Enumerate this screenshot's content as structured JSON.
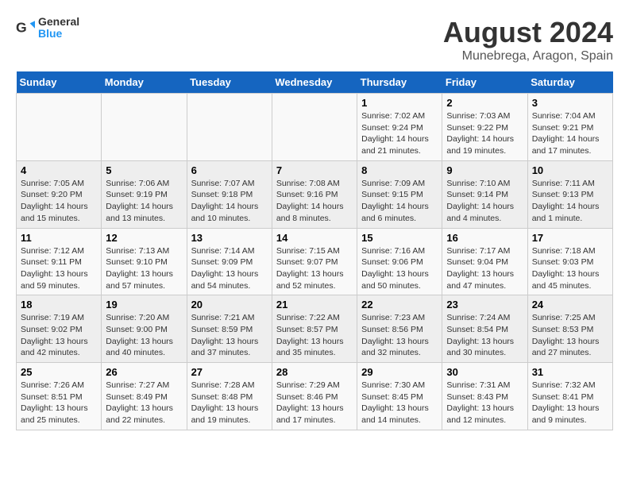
{
  "header": {
    "logo_general": "General",
    "logo_blue": "Blue",
    "title": "August 2024",
    "subtitle": "Munebrega, Aragon, Spain"
  },
  "calendar": {
    "days_of_week": [
      "Sunday",
      "Monday",
      "Tuesday",
      "Wednesday",
      "Thursday",
      "Friday",
      "Saturday"
    ],
    "weeks": [
      [
        {
          "day": "",
          "info": ""
        },
        {
          "day": "",
          "info": ""
        },
        {
          "day": "",
          "info": ""
        },
        {
          "day": "",
          "info": ""
        },
        {
          "day": "1",
          "info": "Sunrise: 7:02 AM\nSunset: 9:24 PM\nDaylight: 14 hours\nand 21 minutes."
        },
        {
          "day": "2",
          "info": "Sunrise: 7:03 AM\nSunset: 9:22 PM\nDaylight: 14 hours\nand 19 minutes."
        },
        {
          "day": "3",
          "info": "Sunrise: 7:04 AM\nSunset: 9:21 PM\nDaylight: 14 hours\nand 17 minutes."
        }
      ],
      [
        {
          "day": "4",
          "info": "Sunrise: 7:05 AM\nSunset: 9:20 PM\nDaylight: 14 hours\nand 15 minutes."
        },
        {
          "day": "5",
          "info": "Sunrise: 7:06 AM\nSunset: 9:19 PM\nDaylight: 14 hours\nand 13 minutes."
        },
        {
          "day": "6",
          "info": "Sunrise: 7:07 AM\nSunset: 9:18 PM\nDaylight: 14 hours\nand 10 minutes."
        },
        {
          "day": "7",
          "info": "Sunrise: 7:08 AM\nSunset: 9:16 PM\nDaylight: 14 hours\nand 8 minutes."
        },
        {
          "day": "8",
          "info": "Sunrise: 7:09 AM\nSunset: 9:15 PM\nDaylight: 14 hours\nand 6 minutes."
        },
        {
          "day": "9",
          "info": "Sunrise: 7:10 AM\nSunset: 9:14 PM\nDaylight: 14 hours\nand 4 minutes."
        },
        {
          "day": "10",
          "info": "Sunrise: 7:11 AM\nSunset: 9:13 PM\nDaylight: 14 hours\nand 1 minute."
        }
      ],
      [
        {
          "day": "11",
          "info": "Sunrise: 7:12 AM\nSunset: 9:11 PM\nDaylight: 13 hours\nand 59 minutes."
        },
        {
          "day": "12",
          "info": "Sunrise: 7:13 AM\nSunset: 9:10 PM\nDaylight: 13 hours\nand 57 minutes."
        },
        {
          "day": "13",
          "info": "Sunrise: 7:14 AM\nSunset: 9:09 PM\nDaylight: 13 hours\nand 54 minutes."
        },
        {
          "day": "14",
          "info": "Sunrise: 7:15 AM\nSunset: 9:07 PM\nDaylight: 13 hours\nand 52 minutes."
        },
        {
          "day": "15",
          "info": "Sunrise: 7:16 AM\nSunset: 9:06 PM\nDaylight: 13 hours\nand 50 minutes."
        },
        {
          "day": "16",
          "info": "Sunrise: 7:17 AM\nSunset: 9:04 PM\nDaylight: 13 hours\nand 47 minutes."
        },
        {
          "day": "17",
          "info": "Sunrise: 7:18 AM\nSunset: 9:03 PM\nDaylight: 13 hours\nand 45 minutes."
        }
      ],
      [
        {
          "day": "18",
          "info": "Sunrise: 7:19 AM\nSunset: 9:02 PM\nDaylight: 13 hours\nand 42 minutes."
        },
        {
          "day": "19",
          "info": "Sunrise: 7:20 AM\nSunset: 9:00 PM\nDaylight: 13 hours\nand 40 minutes."
        },
        {
          "day": "20",
          "info": "Sunrise: 7:21 AM\nSunset: 8:59 PM\nDaylight: 13 hours\nand 37 minutes."
        },
        {
          "day": "21",
          "info": "Sunrise: 7:22 AM\nSunset: 8:57 PM\nDaylight: 13 hours\nand 35 minutes."
        },
        {
          "day": "22",
          "info": "Sunrise: 7:23 AM\nSunset: 8:56 PM\nDaylight: 13 hours\nand 32 minutes."
        },
        {
          "day": "23",
          "info": "Sunrise: 7:24 AM\nSunset: 8:54 PM\nDaylight: 13 hours\nand 30 minutes."
        },
        {
          "day": "24",
          "info": "Sunrise: 7:25 AM\nSunset: 8:53 PM\nDaylight: 13 hours\nand 27 minutes."
        }
      ],
      [
        {
          "day": "25",
          "info": "Sunrise: 7:26 AM\nSunset: 8:51 PM\nDaylight: 13 hours\nand 25 minutes."
        },
        {
          "day": "26",
          "info": "Sunrise: 7:27 AM\nSunset: 8:49 PM\nDaylight: 13 hours\nand 22 minutes."
        },
        {
          "day": "27",
          "info": "Sunrise: 7:28 AM\nSunset: 8:48 PM\nDaylight: 13 hours\nand 19 minutes."
        },
        {
          "day": "28",
          "info": "Sunrise: 7:29 AM\nSunset: 8:46 PM\nDaylight: 13 hours\nand 17 minutes."
        },
        {
          "day": "29",
          "info": "Sunrise: 7:30 AM\nSunset: 8:45 PM\nDaylight: 13 hours\nand 14 minutes."
        },
        {
          "day": "30",
          "info": "Sunrise: 7:31 AM\nSunset: 8:43 PM\nDaylight: 13 hours\nand 12 minutes."
        },
        {
          "day": "31",
          "info": "Sunrise: 7:32 AM\nSunset: 8:41 PM\nDaylight: 13 hours\nand 9 minutes."
        }
      ]
    ]
  }
}
